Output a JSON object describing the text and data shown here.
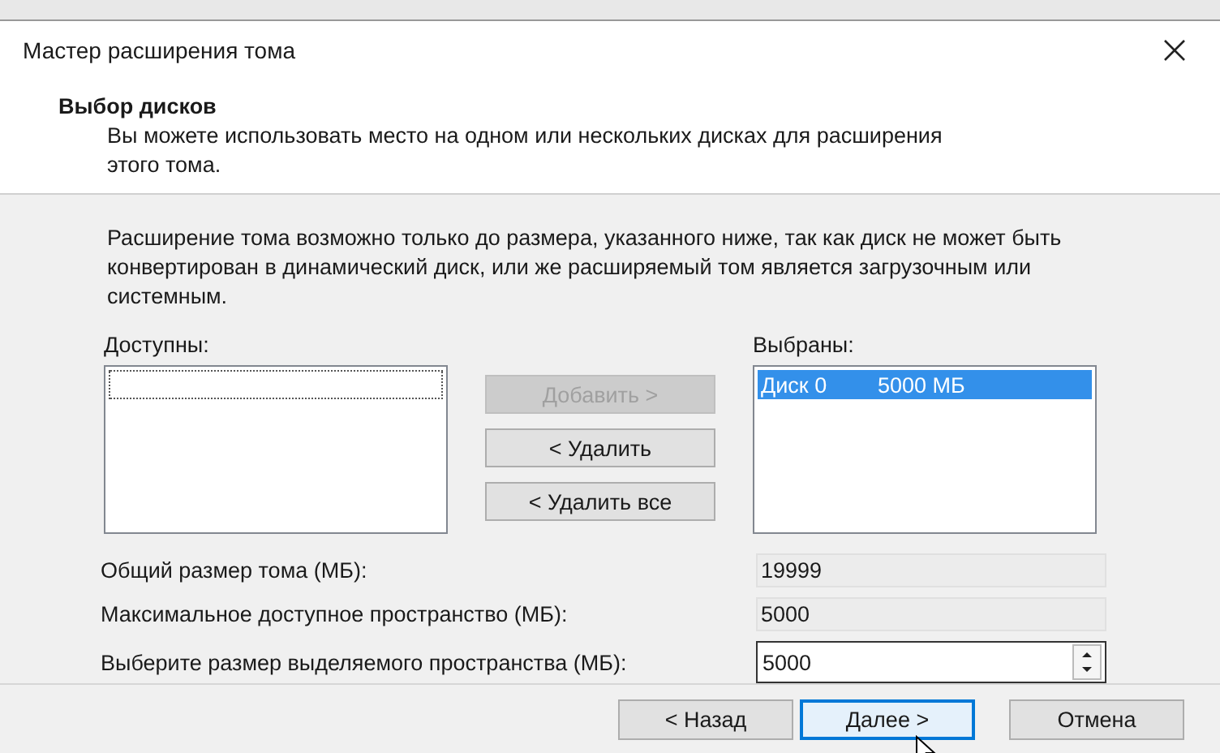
{
  "window": {
    "title": "Мастер расширения тома"
  },
  "header": {
    "title": "Выбор дисков",
    "subtitle": "Вы можете использовать место на одном или нескольких дисках для расширения этого тома."
  },
  "description": "Расширение тома возможно только до размера, указанного ниже, так как диск не может быть конвертирован в динамический диск, или же расширяемый том является загрузочным или системным.",
  "available": {
    "label": "Доступны:"
  },
  "move_buttons": [
    {
      "label": "Добавить >",
      "disabled": true
    },
    {
      "label": "< Удалить",
      "disabled": false
    },
    {
      "label": "< Удалить все",
      "disabled": false
    }
  ],
  "chosen": {
    "label": "Выбраны:",
    "items": [
      {
        "disk": "Диск 0",
        "size": "5000 МБ",
        "selected": true
      }
    ]
  },
  "fields": [
    {
      "kind": "readonly",
      "label": "Общий размер тома (МБ):",
      "value": "19999"
    },
    {
      "kind": "readonly",
      "label": "Максимальное доступное пространство (МБ):",
      "value": "5000"
    },
    {
      "kind": "spinner",
      "label": "Выберите размер выделяемого пространства (МБ):",
      "value": "5000"
    }
  ],
  "nav_buttons": [
    {
      "label": "< Назад",
      "default": false
    },
    {
      "label": "Далее >",
      "default": true
    },
    {
      "label": "Отмена",
      "default": false
    }
  ]
}
